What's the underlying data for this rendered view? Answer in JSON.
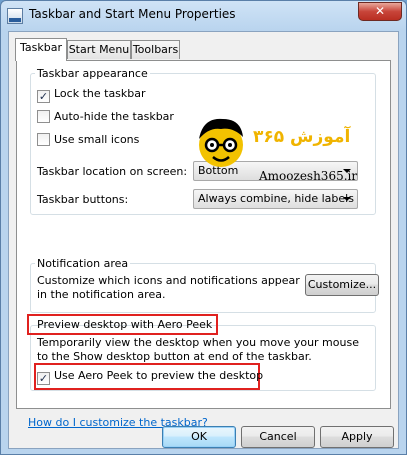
{
  "window": {
    "title": "Taskbar and Start Menu Properties",
    "close_glyph": "✕"
  },
  "tabs": [
    {
      "label": "Taskbar"
    },
    {
      "label": "Start Menu"
    },
    {
      "label": "Toolbars"
    }
  ],
  "taskbar_appearance": {
    "title": "Taskbar appearance",
    "lock": {
      "label": "Lock the taskbar",
      "checked": true
    },
    "autohide": {
      "label": "Auto-hide the taskbar",
      "checked": false
    },
    "small_icons": {
      "label": "Use small icons",
      "checked": false
    },
    "location_label": "Taskbar location on screen:",
    "location_value": "Bottom",
    "buttons_label": "Taskbar buttons:",
    "buttons_value": "Always combine, hide labels"
  },
  "watermark": {
    "text_fa": "آموزش ۳۶۵",
    "text_en": "Amoozesh365.ir"
  },
  "notification_area": {
    "title": "Notification area",
    "description": "Customize which icons and notifications appear in the notification area.",
    "customize_button": "Customize..."
  },
  "aero_peek": {
    "title": "Preview desktop with Aero Peek",
    "description": "Temporarily view the desktop when you move your mouse to the Show desktop button at end of the taskbar.",
    "checkbox": {
      "label": "Use Aero Peek to preview the desktop",
      "checked": true
    }
  },
  "help_link": "How do I customize the taskbar?",
  "footer": {
    "ok": "OK",
    "cancel": "Cancel",
    "apply": "Apply"
  },
  "colors": {
    "highlight": "#e0211f",
    "link": "#0066cc",
    "logo_text": "#f0b400"
  }
}
